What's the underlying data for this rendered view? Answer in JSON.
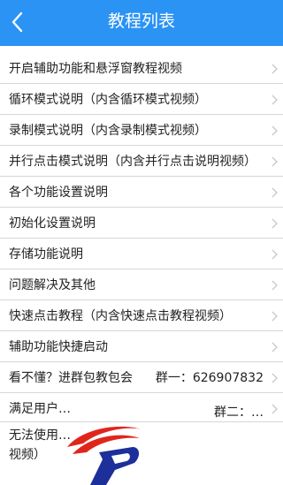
{
  "header": {
    "title": "教程列表"
  },
  "list": {
    "items": [
      {
        "label": "开启辅助功能和悬浮窗教程视频"
      },
      {
        "label": "循环模式说明（内含循环模式视频）"
      },
      {
        "label": "录制模式说明（内含录制模式视频）"
      },
      {
        "label": "并行点击模式说明（内含并行点击说明视频）"
      },
      {
        "label": "各个功能设置说明"
      },
      {
        "label": "初始化设置说明"
      },
      {
        "label": "存储功能说明"
      },
      {
        "label": "问题解决及其他"
      },
      {
        "label": "快速点击教程（内含快速点击教程视频）"
      },
      {
        "label": "辅助功能快捷启动"
      },
      {
        "label": "看不懂？进群包教包会",
        "group": "群一：626907832"
      },
      {
        "label": "满足用户…",
        "group": "群二：…"
      },
      {
        "label": "无法使用… 视频）"
      }
    ]
  },
  "colors": {
    "header": "#2a93f4",
    "divider": "#d6d6d6",
    "chevron": "#c8c8c8"
  },
  "icons": {
    "back": "chevron-left-icon",
    "row": "chevron-right-icon"
  }
}
